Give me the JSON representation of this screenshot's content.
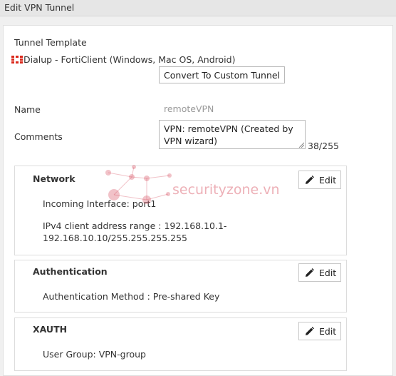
{
  "window": {
    "title": "Edit VPN Tunnel"
  },
  "tunnel_template": {
    "label": "Tunnel Template",
    "value": "Dialup - FortiClient (Windows, Mac OS, Android)",
    "icon": "fortinet-logo-icon",
    "convert_button": "Convert To Custom Tunnel"
  },
  "name": {
    "label": "Name",
    "value": "remoteVPN"
  },
  "comments": {
    "label": "Comments",
    "value": "VPN: remoteVPN (Created by VPN wizard)",
    "counter": "38/255"
  },
  "sections": {
    "network": {
      "title": "Network",
      "edit_label": "Edit",
      "incoming_interface": "Incoming Interface: port1",
      "ipv4_range_line1": "IPv4 client address range : 192.168.10.1-",
      "ipv4_range_line2": "192.168.10.10/255.255.255.255"
    },
    "authentication": {
      "title": "Authentication",
      "edit_label": "Edit",
      "method": "Authentication Method : Pre-shared Key"
    },
    "xauth": {
      "title": "XAUTH",
      "edit_label": "Edit",
      "user_group": "User Group: VPN-group"
    }
  },
  "watermark": {
    "text": "securityzone.vn"
  },
  "colors": {
    "fortinet_red": "#da291c",
    "watermark": "#d65060"
  }
}
